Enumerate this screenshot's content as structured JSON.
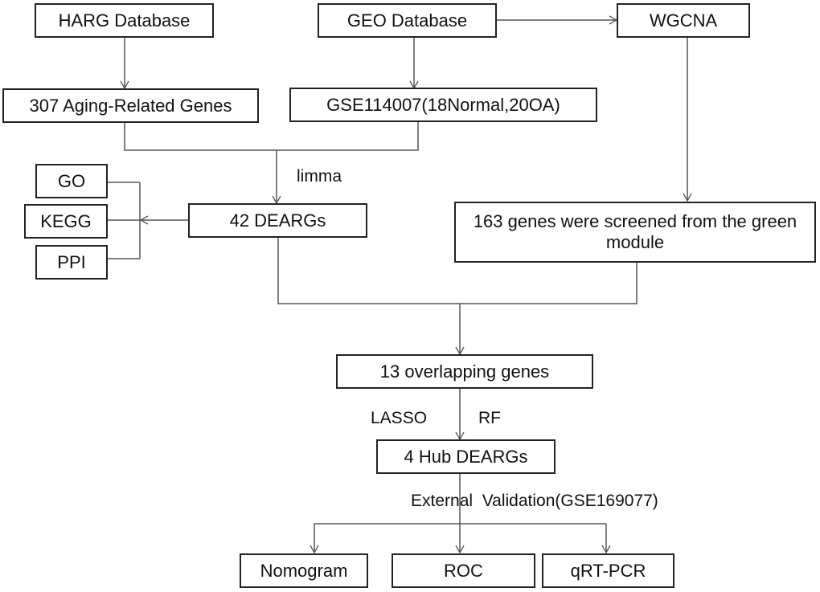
{
  "nodes": {
    "harg": "HARG Database",
    "geo": "GEO Database",
    "wgcna": "WGCNA",
    "aging_genes": "307 Aging-Related Genes",
    "gse": "GSE114007(18Normal,20OA)",
    "go": "GO",
    "kegg": "KEGG",
    "ppi": "PPI",
    "deargs": "42 DEARGs",
    "green_module": "163 genes were screened from the green module",
    "overlap": "13 overlapping genes",
    "hub": "4 Hub DEARGs",
    "nomogram": "Nomogram",
    "roc": "ROC",
    "qrtpcr": "qRT-PCR"
  },
  "edge_labels": {
    "limma": "limma",
    "lasso": "LASSO",
    "rf": "RF",
    "validation": "External  Validation(GSE169077)"
  },
  "colors": {
    "line": "#555555",
    "border": "#222222"
  }
}
